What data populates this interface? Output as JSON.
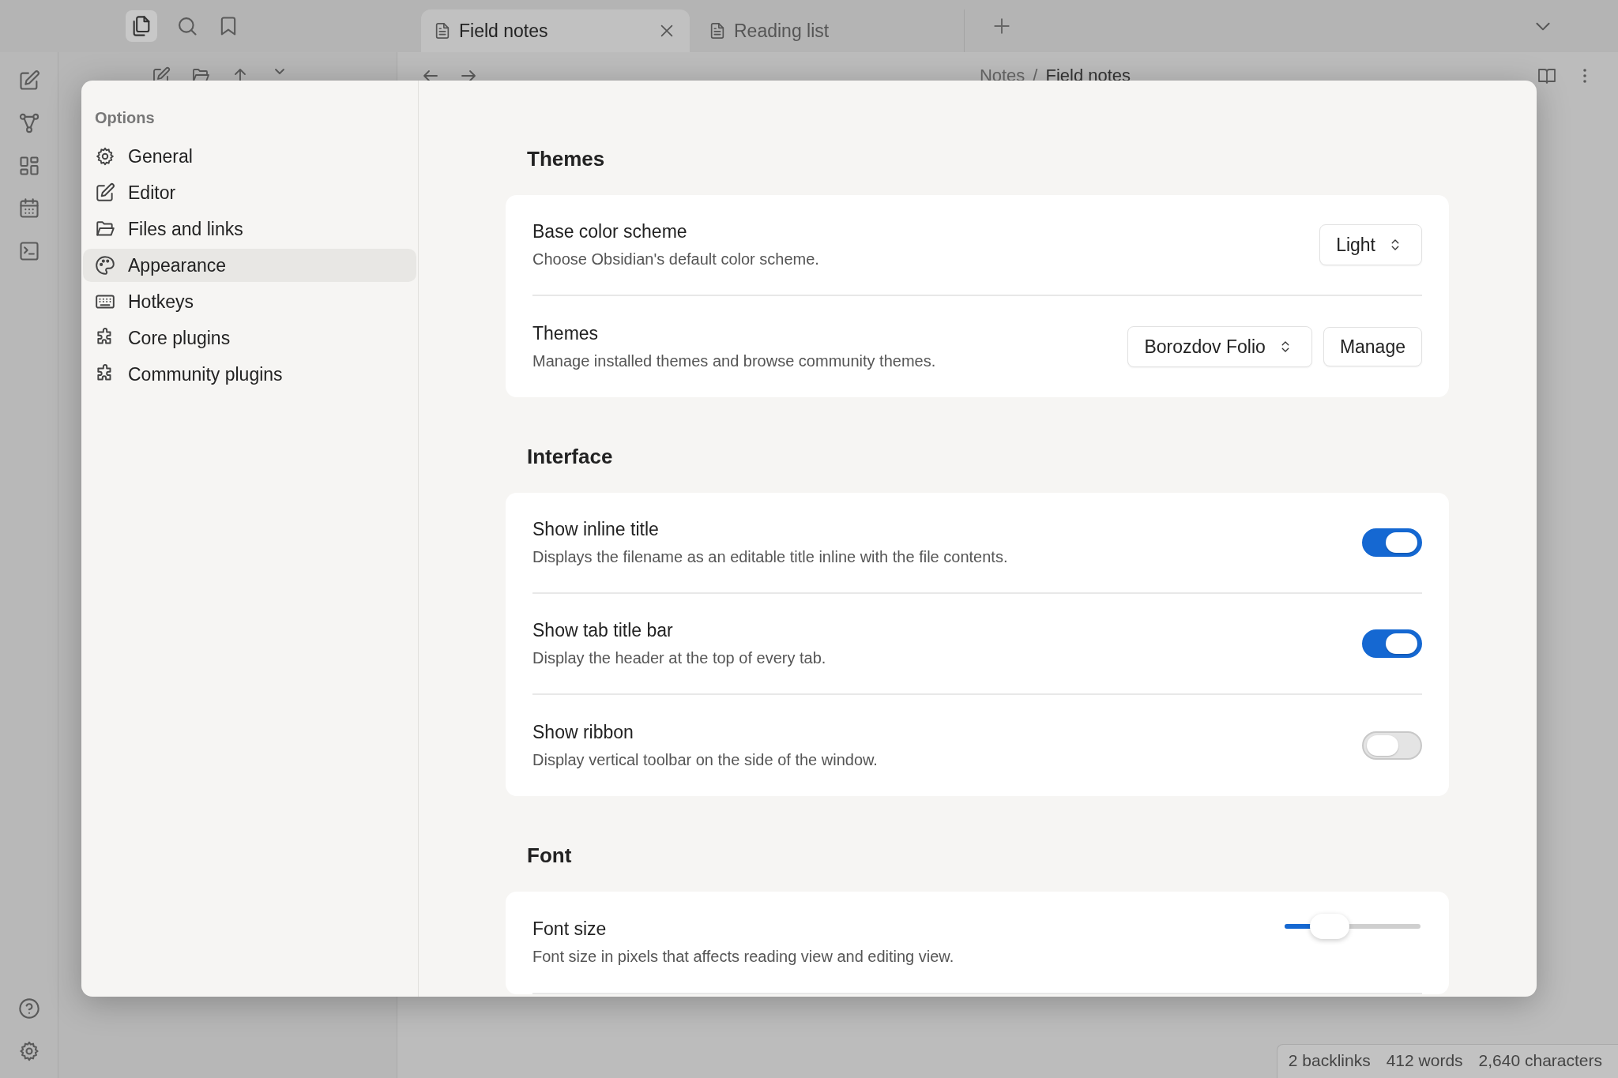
{
  "tabs": [
    {
      "label": "Field notes",
      "selected": true
    },
    {
      "label": "Reading list",
      "selected": false
    }
  ],
  "breadcrumb": {
    "parent": "Notes",
    "separator": "/",
    "current": "Field notes"
  },
  "settings": {
    "sidebar": {
      "heading": "Options",
      "items": [
        {
          "label": "General",
          "selected": false
        },
        {
          "label": "Editor",
          "selected": false
        },
        {
          "label": "Files and links",
          "selected": false
        },
        {
          "label": "Appearance",
          "selected": true
        },
        {
          "label": "Hotkeys",
          "selected": false
        },
        {
          "label": "Core plugins",
          "selected": false
        },
        {
          "label": "Community plugins",
          "selected": false
        }
      ]
    },
    "sections": [
      {
        "heading": "Themes",
        "rows": [
          {
            "title": "Base color scheme",
            "description": "Choose Obsidian's default color scheme.",
            "controls": [
              {
                "kind": "dropdown",
                "value": "Light"
              }
            ]
          },
          {
            "title": "Themes",
            "description": "Manage installed themes and browse community themes.",
            "controls": [
              {
                "kind": "dropdown",
                "value": "Borozdov Folio"
              },
              {
                "kind": "button",
                "label": "Manage"
              }
            ]
          }
        ]
      },
      {
        "heading": "Interface",
        "rows": [
          {
            "title": "Show inline title",
            "description": "Displays the filename as an editable title inline with the file contents.",
            "controls": [
              {
                "kind": "toggle",
                "on": true
              }
            ]
          },
          {
            "title": "Show tab title bar",
            "description": "Display the header at the top of every tab.",
            "controls": [
              {
                "kind": "toggle",
                "on": true
              }
            ]
          },
          {
            "title": "Show ribbon",
            "description": "Display vertical toolbar on the side of the window.",
            "controls": [
              {
                "kind": "toggle",
                "on": false
              }
            ]
          }
        ]
      },
      {
        "heading": "Font",
        "rows": [
          {
            "title": "Font size",
            "description": "Font size in pixels that affects reading view and editing view.",
            "controls": [
              {
                "kind": "slider",
                "level": 0.33
              }
            ]
          }
        ]
      }
    ]
  },
  "status_bar": [
    "2 backlinks",
    "412 words",
    "2,640 characters"
  ]
}
